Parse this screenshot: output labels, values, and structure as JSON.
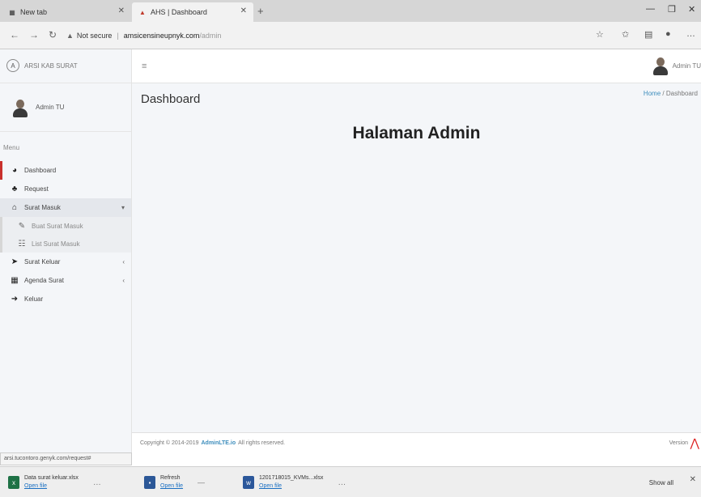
{
  "browser": {
    "tabs": [
      {
        "title": "New tab",
        "icon": "newtab-icon"
      },
      {
        "title": "AHS | Dashboard",
        "icon": "site-favicon"
      }
    ],
    "url_warning": "Not secure",
    "url_host": "amsicensineupnyk.com",
    "url_path": "/admin"
  },
  "app": {
    "brand": "ARSI KAB SURAT",
    "user_name": "Admin TU",
    "menu_header": "Menu",
    "nav": [
      {
        "label": "Dashboard",
        "icon": "dashboard-icon"
      },
      {
        "label": "Request",
        "icon": "bell-icon"
      },
      {
        "label": "Surat Masuk",
        "icon": "inbox-icon"
      },
      {
        "label": "Buat Surat Masuk",
        "icon": "pencil-icon"
      },
      {
        "label": "List Surat Masuk",
        "icon": "list-icon"
      },
      {
        "label": "Surat Keluar",
        "icon": "paper-plane-icon"
      },
      {
        "label": "Agenda Surat",
        "icon": "book-icon"
      },
      {
        "label": "Keluar",
        "icon": "sign-out-icon"
      }
    ],
    "page_title": "Dashboard",
    "breadcrumb": {
      "home": "Home",
      "separator": "/",
      "current": "Dashboard"
    },
    "heading": "Halaman Admin",
    "footer": {
      "prefix": "Copyright © 2014-2019",
      "link": "AdminLTE.io",
      "suffix": "All rights reserved.",
      "version": "Version"
    }
  },
  "status_url": "arsi.tucontoro.genyk.com/request#",
  "downloads": [
    {
      "name": "Data surat keluar.xlsx",
      "action": "Open file",
      "color": "#1e7145"
    },
    {
      "name": "Refresh",
      "action": "Open file",
      "color": "#2b5797"
    },
    {
      "name": "1201718015_KVMs...xlsx",
      "action": "Open file",
      "color": "#2b579a"
    }
  ],
  "shelf": {
    "show_all": "Show all"
  }
}
